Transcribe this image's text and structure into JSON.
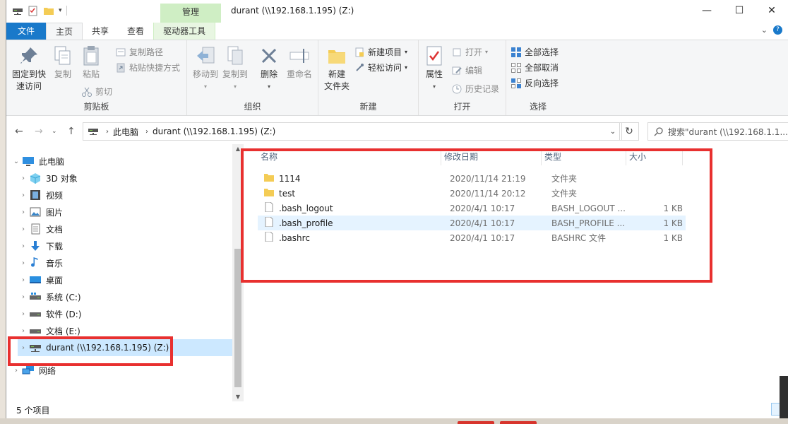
{
  "window": {
    "title": "durant (\\\\192.168.1.195) (Z:)",
    "context_tab": "管理",
    "controls": {
      "minimize": "—",
      "maximize": "☐",
      "close": "✕"
    }
  },
  "tabs": [
    {
      "label": "文件"
    },
    {
      "label": "主页"
    },
    {
      "label": "共享"
    },
    {
      "label": "查看"
    },
    {
      "label": "驱动器工具"
    }
  ],
  "ribbon": {
    "clipboard": {
      "label": "剪贴板",
      "pin": "固定到快\n速访问",
      "pin_l1": "固定到快",
      "pin_l2": "速访问",
      "copy": "复制",
      "paste": "粘贴",
      "copy_path": "复制路径",
      "paste_shortcut": "粘贴快捷方式",
      "cut": "剪切"
    },
    "organize": {
      "label": "组织",
      "move_to": "移动到",
      "copy_to": "复制到",
      "delete": "删除",
      "rename": "重命名"
    },
    "new": {
      "label": "新建",
      "new_folder_l1": "新建",
      "new_folder_l2": "文件夹",
      "new_item": "新建项目",
      "easy_access": "轻松访问"
    },
    "open": {
      "label": "打开",
      "properties": "属性",
      "open": "打开",
      "edit": "编辑",
      "history": "历史记录"
    },
    "select": {
      "label": "选择",
      "select_all": "全部选择",
      "select_none": "全部取消",
      "invert": "反向选择"
    }
  },
  "address": {
    "crumbs": [
      "此电脑",
      "durant (\\\\192.168.1.195) (Z:)"
    ],
    "search_placeholder": "搜索\"durant (\\\\192.168.1.1..."
  },
  "nav": {
    "items": [
      {
        "label": "此电脑",
        "icon": "computer-icon"
      },
      {
        "label": "3D 对象",
        "icon": "cube-icon"
      },
      {
        "label": "视频",
        "icon": "video-icon"
      },
      {
        "label": "图片",
        "icon": "picture-icon"
      },
      {
        "label": "文档",
        "icon": "document-icon"
      },
      {
        "label": "下载",
        "icon": "download-icon"
      },
      {
        "label": "音乐",
        "icon": "music-icon"
      },
      {
        "label": "桌面",
        "icon": "desktop-icon"
      },
      {
        "label": "系统 (C:)",
        "icon": "drive-icon"
      },
      {
        "label": "软件 (D:)",
        "icon": "drive-icon"
      },
      {
        "label": "文档 (E:)",
        "icon": "drive-icon"
      },
      {
        "label": "durant (\\\\192.168.1.195) (Z:)",
        "icon": "network-drive-icon"
      },
      {
        "label": "网络",
        "icon": "network-icon"
      }
    ]
  },
  "files": {
    "columns": {
      "name": "名称",
      "date": "修改日期",
      "type": "类型",
      "size": "大小"
    },
    "rows": [
      {
        "name": "1114",
        "date": "2020/11/14 21:19",
        "type": "文件夹",
        "size": "",
        "kind": "folder"
      },
      {
        "name": "test",
        "date": "2020/11/14 20:12",
        "type": "文件夹",
        "size": "",
        "kind": "folder"
      },
      {
        "name": ".bash_logout",
        "date": "2020/4/1 10:17",
        "type": "BASH_LOGOUT ...",
        "size": "1 KB",
        "kind": "file"
      },
      {
        "name": ".bash_profile",
        "date": "2020/4/1 10:17",
        "type": "BASH_PROFILE ...",
        "size": "1 KB",
        "kind": "file"
      },
      {
        "name": ".bashrc",
        "date": "2020/4/1 10:17",
        "type": "BASHRC 文件",
        "size": "1 KB",
        "kind": "file"
      }
    ]
  },
  "status": {
    "count": "5 个项目"
  },
  "colors": {
    "accent": "#1979ca",
    "highlight": "#e8302f",
    "selection": "#cce8ff",
    "manage_tab": "#cfeec4"
  }
}
